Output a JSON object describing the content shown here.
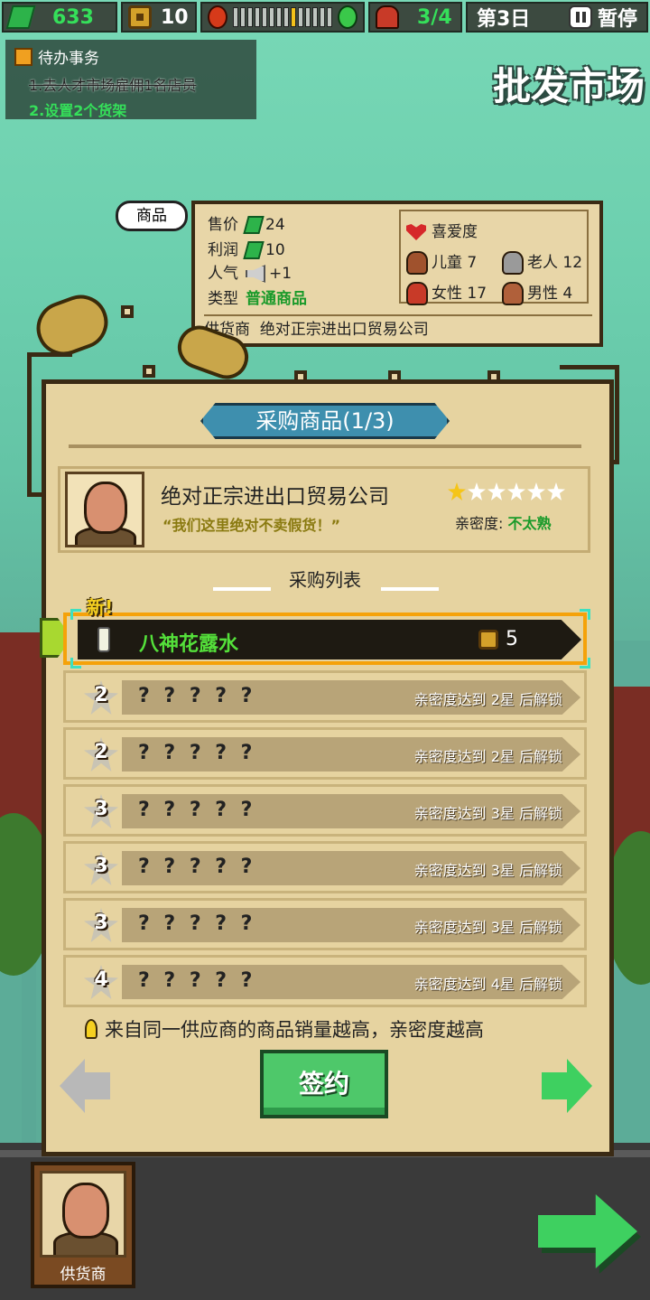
{
  "hud": {
    "cash": "633",
    "coins": "10",
    "mood_level": 0.65,
    "staff": "3/4",
    "day": "第3日",
    "pause_label": "暂停"
  },
  "todo": {
    "title": "待办事务",
    "items": [
      {
        "text": "1.去人才市场雇佣1名店员",
        "done": true
      },
      {
        "text": "2.设置2个货架",
        "done": false
      }
    ]
  },
  "location_title": "批发市场",
  "product_info": {
    "bubble": "商品",
    "price_label": "售价",
    "price": "24",
    "profit_label": "利润",
    "profit": "10",
    "popularity_label": "人气",
    "popularity": "+1",
    "type_label": "类型",
    "type": "普通商品",
    "favor_label": "喜爱度",
    "favor": [
      {
        "group": "儿童",
        "value": "7",
        "color": "#a0522d"
      },
      {
        "group": "老人",
        "value": "12",
        "color": "#9a9a9a"
      },
      {
        "group": "女性",
        "value": "17",
        "color": "#c83a28"
      },
      {
        "group": "男性",
        "value": "4",
        "color": "#b0603a"
      }
    ],
    "supplier_label": "供货商",
    "supplier": "绝对正宗进出口贸易公司"
  },
  "panel": {
    "title": "采购商品(1/3)",
    "supplier_name": "绝对正宗进出口贸易公司",
    "supplier_quote": "“我们这里绝对不卖假货！”",
    "stars_filled": 1,
    "stars_total": 6,
    "intimacy_label": "亲密度:",
    "intimacy_value": "不太熟",
    "list_title": "采购列表",
    "new_tag": "新!",
    "items": [
      {
        "name": "八神花露水",
        "price": "5",
        "selected": true
      },
      {
        "name": "? ? ? ? ?",
        "stars": "2",
        "unlock": "亲密度达到 2星 后解锁"
      },
      {
        "name": "? ? ? ? ?",
        "stars": "2",
        "unlock": "亲密度达到 2星 后解锁"
      },
      {
        "name": "? ? ? ? ?",
        "stars": "3",
        "unlock": "亲密度达到 3星 后解锁"
      },
      {
        "name": "? ? ? ? ?",
        "stars": "3",
        "unlock": "亲密度达到 3星 后解锁"
      },
      {
        "name": "? ? ? ? ?",
        "stars": "3",
        "unlock": "亲密度达到 3星 后解锁"
      },
      {
        "name": "? ? ? ? ?",
        "stars": "4",
        "unlock": "亲密度达到 4星 后解锁"
      }
    ],
    "tip": "来自同一供应商的商品销量越高，亲密度越高",
    "sign_button": "签约"
  },
  "bottom": {
    "supplier_tab_label": "供货商"
  }
}
